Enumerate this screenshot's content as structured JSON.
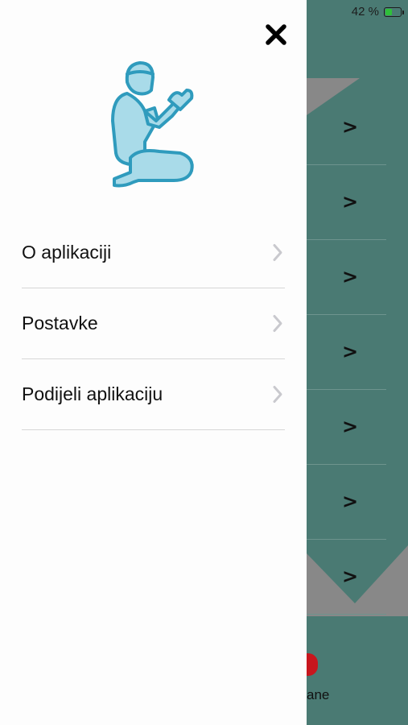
{
  "status_bar": {
    "battery_percent": "42 %",
    "battery_level": 0.42
  },
  "background": {
    "rows": [
      {
        "chevron": ">"
      },
      {
        "chevron": ">"
      },
      {
        "chevron": ">"
      },
      {
        "chevron": ">"
      },
      {
        "chevron": ">"
      },
      {
        "chevron": ">"
      },
      {
        "chevron": ">"
      }
    ],
    "tab_label_partial": "ane"
  },
  "drawer": {
    "close_icon": "close-icon",
    "header_icon": "praying-person-icon",
    "menu": [
      {
        "label": "O aplikaciji",
        "icon": "chevron-right-icon"
      },
      {
        "label": "Postavke",
        "icon": "chevron-right-icon"
      },
      {
        "label": "Podijeli aplikaciju",
        "icon": "chevron-right-icon"
      }
    ]
  },
  "colors": {
    "background_teal": "#4a7a73",
    "drawer_bg": "#fdfdfd",
    "icon_fill": "#a9dbe9",
    "icon_stroke": "#2f9bbd",
    "accent_red": "#c8161d"
  }
}
